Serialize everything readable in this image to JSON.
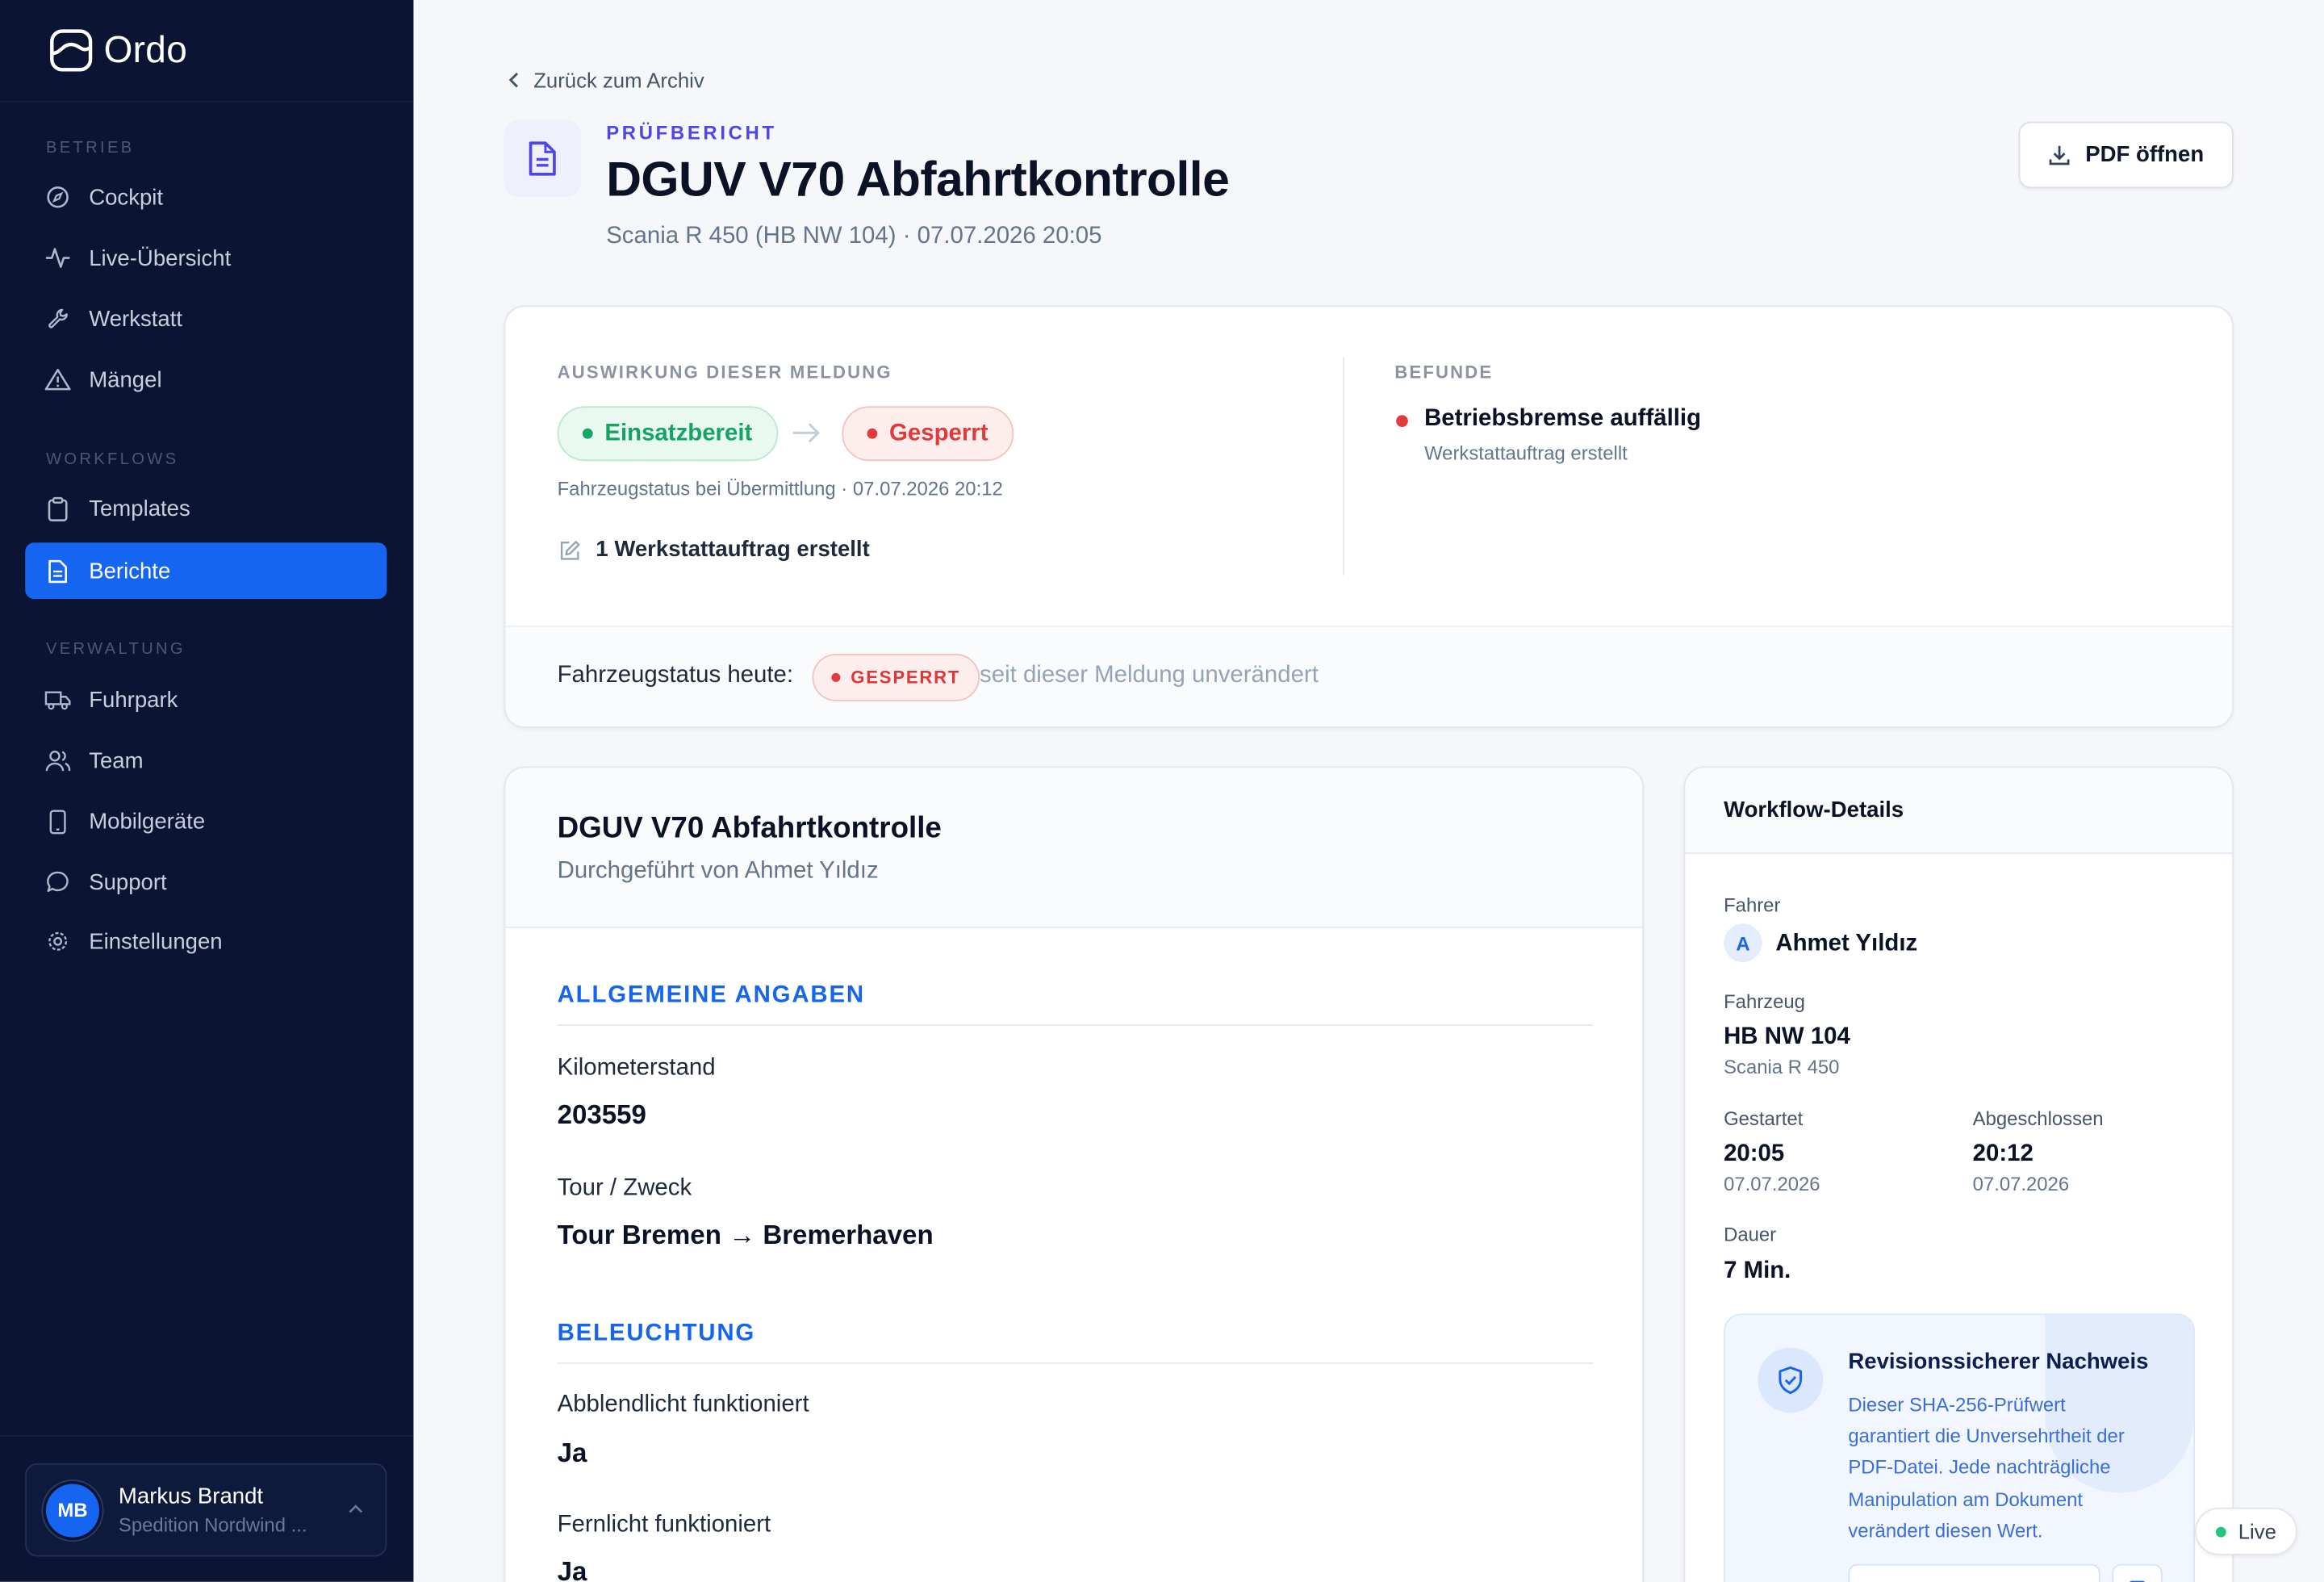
{
  "app": {
    "name": "Ordo"
  },
  "sidebar": {
    "sections": [
      {
        "label": "BETRIEB"
      },
      {
        "label": "WORKFLOWS"
      },
      {
        "label": "VERWALTUNG"
      }
    ],
    "items": [
      {
        "label": "Cockpit",
        "icon": "compass-icon"
      },
      {
        "label": "Live-Übersicht",
        "icon": "activity-icon"
      },
      {
        "label": "Werkstatt",
        "icon": "wrench-icon"
      },
      {
        "label": "Mängel",
        "icon": "warning-icon"
      },
      {
        "label": "Templates",
        "icon": "clipboard-icon"
      },
      {
        "label": "Berichte",
        "icon": "document-icon",
        "active": true
      },
      {
        "label": "Fuhrpark",
        "icon": "truck-icon"
      },
      {
        "label": "Team",
        "icon": "users-icon"
      },
      {
        "label": "Mobilgeräte",
        "icon": "smartphone-icon"
      },
      {
        "label": "Support",
        "icon": "chat-icon"
      },
      {
        "label": "Einstellungen",
        "icon": "gear-icon"
      }
    ],
    "user": {
      "initials": "MB",
      "name": "Markus Brandt",
      "org": "Spedition Nordwind ..."
    }
  },
  "header": {
    "back_label": "Zurück zum Archiv",
    "kicker": "PRÜFBERICHT",
    "title": "DGUV V70 Abfahrtkontrolle",
    "subtitle": "Scania R 450 (HB NW 104) · 07.07.2026 20:05",
    "pdf_button": "PDF öffnen"
  },
  "impact": {
    "heading": "AUSWIRKUNG DIESER MELDUNG",
    "from_status": "Einsatzbereit",
    "to_status": "Gesperrt",
    "status_note": "Fahrzeugstatus bei Übermittlung · 07.07.2026 20:12",
    "orders": "1 Werkstattauftrag erstellt",
    "findings_heading": "BEFUNDE",
    "finding_title": "Betriebsbremse auffällig",
    "finding_sub": "Werkstattauftrag erstellt",
    "today_label": "Fahrzeugstatus heute:",
    "today_badge": "GESPERRT",
    "today_note": "seit dieser Meldung unverändert"
  },
  "report": {
    "title": "DGUV V70 Abfahrtkontrolle",
    "performed_by": "Durchgeführt von Ahmet Yıldız",
    "sections": [
      {
        "heading": "ALLGEMEINE ANGABEN",
        "fields": [
          {
            "label": "Kilometerstand",
            "value": "203559"
          },
          {
            "label": "Tour / Zweck",
            "value": "Tour Bremen → Bremerhaven"
          }
        ]
      },
      {
        "heading": "BELEUCHTUNG",
        "fields": [
          {
            "label": "Abblendlicht funktioniert",
            "value": "Ja"
          },
          {
            "label": "Fernlicht funktioniert",
            "value": "Ja"
          }
        ]
      }
    ]
  },
  "workflow": {
    "title": "Workflow-Details",
    "driver_label": "Fahrer",
    "driver_initial": "A",
    "driver_name": "Ahmet Yıldız",
    "vehicle_label": "Fahrzeug",
    "vehicle_plate": "HB NW 104",
    "vehicle_model": "Scania R 450",
    "started_label": "Gestartet",
    "started_time": "20:05",
    "started_date": "07.07.2026",
    "finished_label": "Abgeschlossen",
    "finished_time": "20:12",
    "finished_date": "07.07.2026",
    "duration_label": "Dauer",
    "duration_value": "7 Min.",
    "proof_title": "Revisionssicherer Nachweis",
    "proof_lines": [
      "Dieser SHA-256-Prüfwert",
      "garantiert die Unversehrtheit der",
      "PDF-Datei. Jede nachträgliche",
      "Manipulation am Dokument",
      "verändert diesen Wert."
    ]
  },
  "live_badge": "Live",
  "colors": {
    "sidebar_bg": "#0b1533",
    "accent": "#1565f0",
    "danger": "#e03a3a",
    "success": "#14a464",
    "kicker": "#4f46e5"
  }
}
